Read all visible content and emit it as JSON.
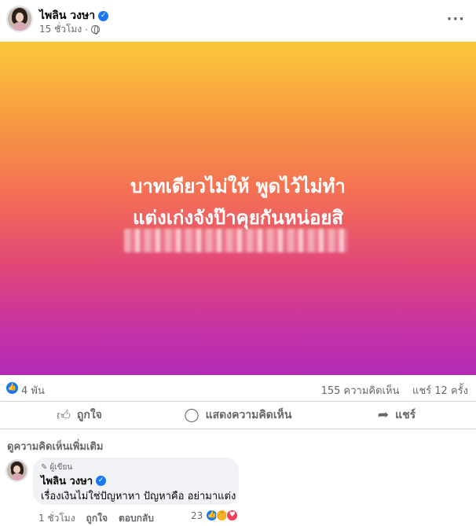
{
  "post": {
    "author": "ไพลิน วงษา",
    "time": "15 ชั่วโมง",
    "banner_line1": "บาทเดียวไม่ให้ พูดไว้ไม่ทำ",
    "banner_line2": "แต่งเก่งจังป๊าคุยกันหน่อยสิ"
  },
  "stats": {
    "likes": "4 พัน",
    "comments": "155 ความคิดเห็น",
    "shares": "แชร์ 12 ครั้ง"
  },
  "actions": {
    "like": "ถูกใจ",
    "comment": "แสดงความคิดเห็น",
    "share": "แชร์"
  },
  "comments_section": {
    "more_label": "ดูความคิดเห็นเพิ่มเติม"
  },
  "comment": {
    "author_tag": "ผู้เขียน",
    "author": "ไพลิน วงษา",
    "text": "เรื่องเงินไม่ใช่ปัญหาหา ปัญหาคือ อย่ามาแต่ง",
    "time": "1 ชั่วโมง",
    "like": "ถูกใจ",
    "reply": "ตอบกลับ",
    "reactions": "23"
  },
  "icons": [
    "verified-icon",
    "globe-icon",
    "more-icon",
    "like-icon",
    "comment-icon",
    "share-icon",
    "pen-icon",
    "haha-icon",
    "love-icon"
  ],
  "colors": {
    "accent": "#1877f2",
    "muted": "#65676b",
    "bubble": "#f0f2f5"
  }
}
